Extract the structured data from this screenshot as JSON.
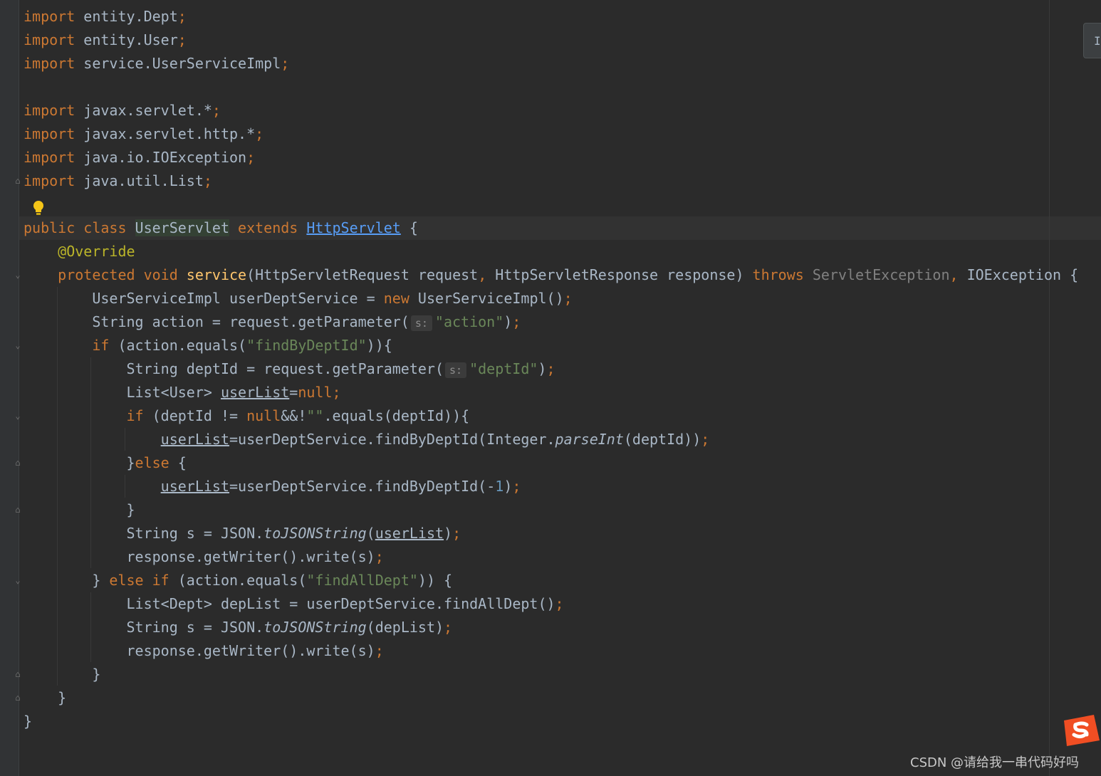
{
  "editor": {
    "language": "Java",
    "caret_line_index": 9,
    "theme": {
      "background": "#2b2b2b",
      "keyword": "#cc7832",
      "string": "#6a8759",
      "annotation": "#bbb529",
      "method": "#ffc66d",
      "number": "#6897bb"
    },
    "lines": [
      [
        {
          "t": "import",
          "c": "kw"
        },
        {
          "t": " entity.Dept"
        },
        {
          "t": ";",
          "c": "kw"
        }
      ],
      [
        {
          "t": "import",
          "c": "kw"
        },
        {
          "t": " entity.User"
        },
        {
          "t": ";",
          "c": "kw"
        }
      ],
      [
        {
          "t": "import",
          "c": "kw"
        },
        {
          "t": " service.UserServiceImpl"
        },
        {
          "t": ";",
          "c": "kw"
        }
      ],
      [],
      [
        {
          "t": "import",
          "c": "kw"
        },
        {
          "t": " javax.servlet.*"
        },
        {
          "t": ";",
          "c": "kw"
        }
      ],
      [
        {
          "t": "import",
          "c": "kw"
        },
        {
          "t": " javax.servlet.http.*"
        },
        {
          "t": ";",
          "c": "kw"
        }
      ],
      [
        {
          "t": "import",
          "c": "kw"
        },
        {
          "t": " java.io.IOException"
        },
        {
          "t": ";",
          "c": "kw"
        }
      ],
      [
        {
          "t": "import",
          "c": "kw"
        },
        {
          "t": " java.util.List"
        },
        {
          "t": ";",
          "c": "kw"
        }
      ],
      [],
      [
        {
          "t": "public class ",
          "c": "kw"
        },
        {
          "t": "UserServlet",
          "c": "hl"
        },
        {
          "t": " extends ",
          "c": "kw"
        },
        {
          "t": "HttpServlet",
          "c": "link"
        },
        {
          "t": " {"
        }
      ],
      [
        {
          "t": "    "
        },
        {
          "t": "@Override",
          "c": "ann"
        }
      ],
      [
        {
          "t": "    "
        },
        {
          "t": "protected void ",
          "c": "kw"
        },
        {
          "t": "service",
          "c": "fn"
        },
        {
          "t": "(HttpServletRequest request"
        },
        {
          "t": ", ",
          "c": "kw"
        },
        {
          "t": "HttpServletResponse response) "
        },
        {
          "t": "throws ",
          "c": "kw"
        },
        {
          "t": "ServletException",
          "c": "gray"
        },
        {
          "t": ", ",
          "c": "kw"
        },
        {
          "t": "IOException {"
        }
      ],
      [
        {
          "t": "        UserServiceImpl userDeptService = "
        },
        {
          "t": "new ",
          "c": "kw"
        },
        {
          "t": "UserServiceImpl()"
        },
        {
          "t": ";",
          "c": "kw"
        }
      ],
      [
        {
          "t": "        String action = request.getParameter("
        },
        {
          "t": "s:",
          "c": "hint"
        },
        {
          "t": "\"action\"",
          "c": "str"
        },
        {
          "t": ")"
        },
        {
          "t": ";",
          "c": "kw"
        }
      ],
      [
        {
          "t": "        "
        },
        {
          "t": "if ",
          "c": "kw"
        },
        {
          "t": "(action.equals("
        },
        {
          "t": "\"findByDeptId\"",
          "c": "str"
        },
        {
          "t": ")){"
        }
      ],
      [
        {
          "t": "            String deptId = request.getParameter("
        },
        {
          "t": "s:",
          "c": "hint"
        },
        {
          "t": "\"deptId\"",
          "c": "str"
        },
        {
          "t": ")"
        },
        {
          "t": ";",
          "c": "kw"
        }
      ],
      [
        {
          "t": "            List<User> "
        },
        {
          "t": "userList",
          "c": "uline"
        },
        {
          "t": "="
        },
        {
          "t": "null",
          "c": "kw"
        },
        {
          "t": ";",
          "c": "kw"
        }
      ],
      [
        {
          "t": "            "
        },
        {
          "t": "if ",
          "c": "kw"
        },
        {
          "t": "(deptId != "
        },
        {
          "t": "null",
          "c": "kw"
        },
        {
          "t": "&&!"
        },
        {
          "t": "\"\"",
          "c": "str"
        },
        {
          "t": ".equals(deptId)){"
        }
      ],
      [
        {
          "t": "                "
        },
        {
          "t": "userList",
          "c": "uline"
        },
        {
          "t": "=userDeptService.findByDeptId(Integer."
        },
        {
          "t": "parseInt",
          "c": "ital"
        },
        {
          "t": "(deptId))"
        },
        {
          "t": ";",
          "c": "kw"
        }
      ],
      [
        {
          "t": "            }"
        },
        {
          "t": "else ",
          "c": "kw"
        },
        {
          "t": "{"
        }
      ],
      [
        {
          "t": "                "
        },
        {
          "t": "userList",
          "c": "uline"
        },
        {
          "t": "=userDeptService.findByDeptId(-"
        },
        {
          "t": "1",
          "c": "num"
        },
        {
          "t": ")"
        },
        {
          "t": ";",
          "c": "kw"
        }
      ],
      [
        {
          "t": "            }"
        }
      ],
      [
        {
          "t": "            String s = JSON."
        },
        {
          "t": "toJSONString",
          "c": "ital"
        },
        {
          "t": "("
        },
        {
          "t": "userList",
          "c": "uline"
        },
        {
          "t": ")"
        },
        {
          "t": ";",
          "c": "kw"
        }
      ],
      [
        {
          "t": "            response.getWriter().write(s)"
        },
        {
          "t": ";",
          "c": "kw"
        }
      ],
      [
        {
          "t": "        } "
        },
        {
          "t": "else if ",
          "c": "kw"
        },
        {
          "t": "(action.equals("
        },
        {
          "t": "\"findAllDept\"",
          "c": "str"
        },
        {
          "t": ")) {"
        }
      ],
      [
        {
          "t": "            List<Dept> depList = userDeptService.findAllDept()"
        },
        {
          "t": ";",
          "c": "kw"
        }
      ],
      [
        {
          "t": "            String s = JSON."
        },
        {
          "t": "toJSONString",
          "c": "ital"
        },
        {
          "t": "(depList)"
        },
        {
          "t": ";",
          "c": "kw"
        }
      ],
      [
        {
          "t": "            response.getWriter().write(s)"
        },
        {
          "t": ";",
          "c": "kw"
        }
      ],
      [
        {
          "t": "        }"
        }
      ],
      [
        {
          "t": "    }"
        }
      ],
      [
        {
          "t": "}"
        }
      ]
    ]
  },
  "fold_markers": [
    {
      "line": 7,
      "icon": "fold-end-icon",
      "glyph": "⌂"
    },
    {
      "line": 11,
      "icon": "fold-start-icon",
      "glyph": "⌄"
    },
    {
      "line": 14,
      "icon": "fold-start-icon",
      "glyph": "⌄"
    },
    {
      "line": 17,
      "icon": "fold-start-icon",
      "glyph": "⌄"
    },
    {
      "line": 19,
      "icon": "fold-end-icon",
      "glyph": "⌂"
    },
    {
      "line": 21,
      "icon": "fold-end-icon",
      "glyph": "⌂"
    },
    {
      "line": 24,
      "icon": "fold-start-icon",
      "glyph": "⌄"
    },
    {
      "line": 28,
      "icon": "fold-end-icon",
      "glyph": "⌂"
    },
    {
      "line": 29,
      "icon": "fold-end-icon",
      "glyph": "⌂"
    }
  ],
  "intention_icon": "lightbulb-icon",
  "side_tab": {
    "label": "I"
  },
  "overlay": {
    "ime_logo": "sogou-input-icon",
    "watermark": "CSDN @请给我一串代码好吗"
  }
}
